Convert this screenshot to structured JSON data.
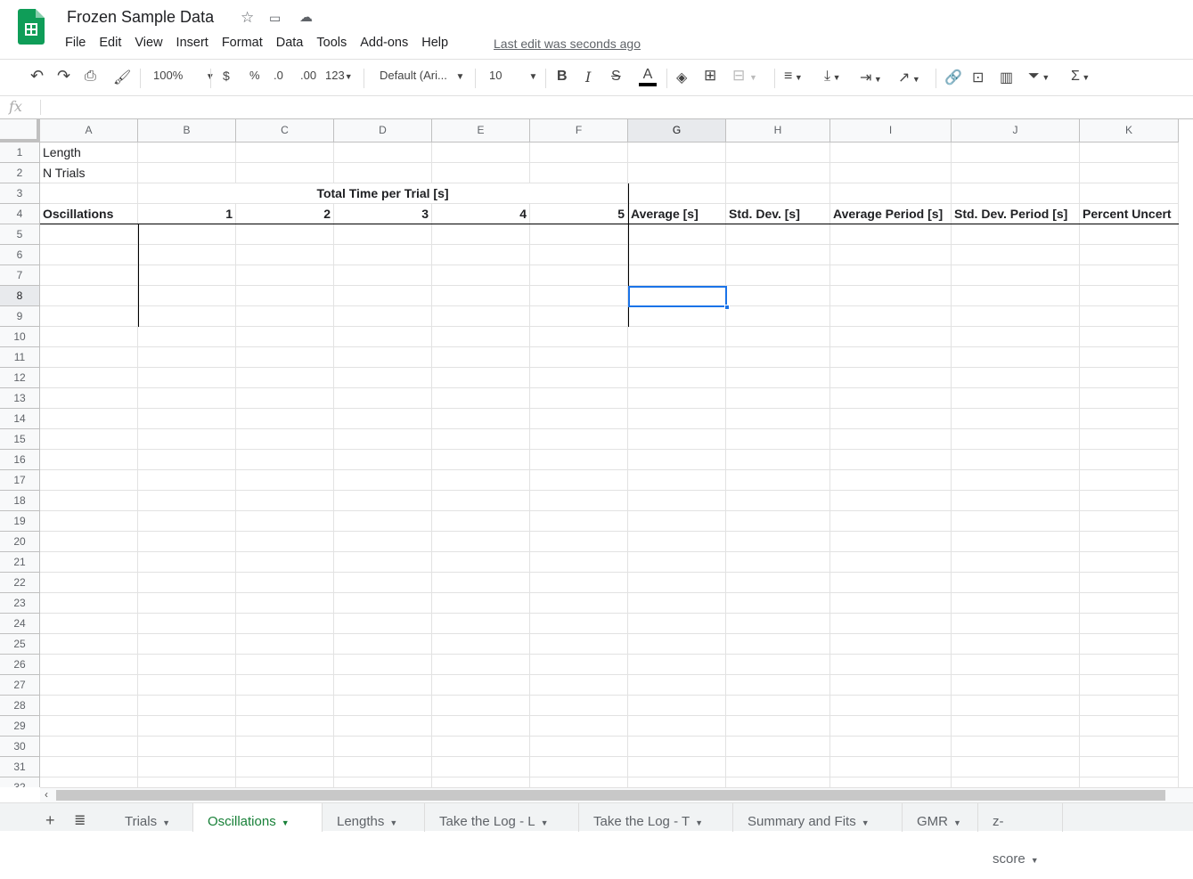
{
  "app": {
    "title": "Frozen Sample Data",
    "last_edit": "Last edit was seconds ago",
    "menu": [
      "File",
      "Edit",
      "View",
      "Insert",
      "Format",
      "Data",
      "Tools",
      "Add-ons",
      "Help"
    ]
  },
  "toolbar": {
    "zoom": "100%",
    "currency": "$",
    "percent": "%",
    "dec_less": ".0",
    "dec_more": ".00",
    "format": "123",
    "font": "Default (Ari...",
    "font_size": "10",
    "bold": "B",
    "italic": "I",
    "strike": "S",
    "text_color": "A",
    "text_color_value": "#000000"
  },
  "formula_bar": {
    "label": "fx",
    "value": ""
  },
  "columns": [
    "A",
    "B",
    "C",
    "D",
    "E",
    "F",
    "G",
    "H",
    "I",
    "J",
    "K"
  ],
  "selected_cell": "G8",
  "rows": [
    [
      "Length",
      "",
      "",
      "",
      "",
      "",
      "",
      "",
      "",
      "",
      ""
    ],
    [
      "N Trials",
      "",
      "",
      "",
      "",
      "",
      "",
      "",
      "",
      "",
      ""
    ],
    [
      "",
      "",
      "",
      "",
      "",
      "",
      "",
      "",
      "",
      "",
      ""
    ],
    [
      "Oscillations",
      "1",
      "2",
      "3",
      "4",
      "5",
      "Average [s]",
      "Std. Dev. [s]",
      "Average Period [s]",
      "Std. Dev. Period [s]",
      "Percent Uncert"
    ]
  ],
  "merged_header": "Total Time per Trial [s]",
  "row_count": 31,
  "tabs": [
    {
      "label": "Trials"
    },
    {
      "label": "Oscillations",
      "active": true
    },
    {
      "label": "Lengths"
    },
    {
      "label": "Take the Log - L"
    },
    {
      "label": "Take the Log - T"
    },
    {
      "label": "Summary and Fits"
    },
    {
      "label": "GMR"
    },
    {
      "label": "z-score"
    }
  ],
  "colors": {
    "accent": "#188038",
    "selection": "#1a73e8"
  }
}
